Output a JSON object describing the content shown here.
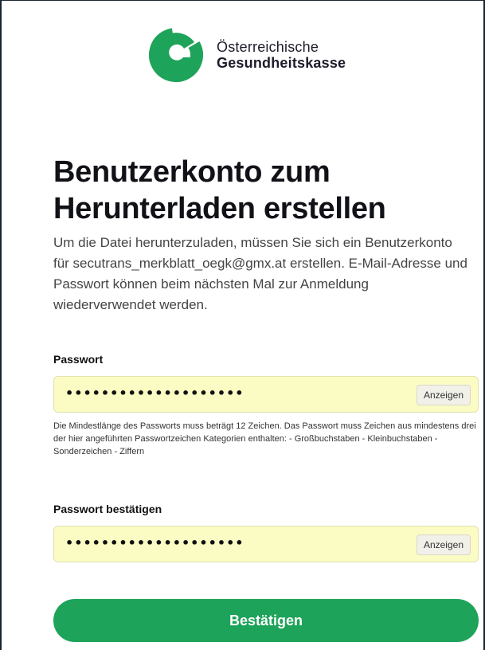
{
  "logo": {
    "line1": "Österreichische",
    "line2": "Gesundheitskasse",
    "icon": "oegk-logo-mark",
    "brand_color": "#1ea35a"
  },
  "heading": {
    "line1": "Benutzerkonto zum",
    "line2": "Herunterladen erstellen"
  },
  "description": "Um die Datei herunterzuladen, müssen Sie sich ein Benutzerkonto für secutrans_merkblatt_oegk@gmx.at erstellen. E-Mail-Adresse und Passwort können beim nächsten Mal zur Anmeldung wiederverwendet werden.",
  "password": {
    "label": "Passwort",
    "value_masked": "••••••••••••••••••••",
    "show_label": "Anzeigen",
    "hint": "Die Mindestlänge des Passworts muss beträgt 12 Zeichen. Das Passwort muss Zeichen aus mindestens drei der hier angeführten Passwortzeichen Kategorien enthalten:  - Großbuchstaben  - Kleinbuchstaben - Sonderzeichen  - Ziffern"
  },
  "password_confirm": {
    "label": "Passwort bestätigen",
    "value_masked": "••••••••••••••••••••",
    "show_label": "Anzeigen"
  },
  "submit": {
    "label": "Bestätigen"
  },
  "colors": {
    "field_autofill_bg": "#fbfbc4",
    "button_green": "#1ea35a"
  }
}
